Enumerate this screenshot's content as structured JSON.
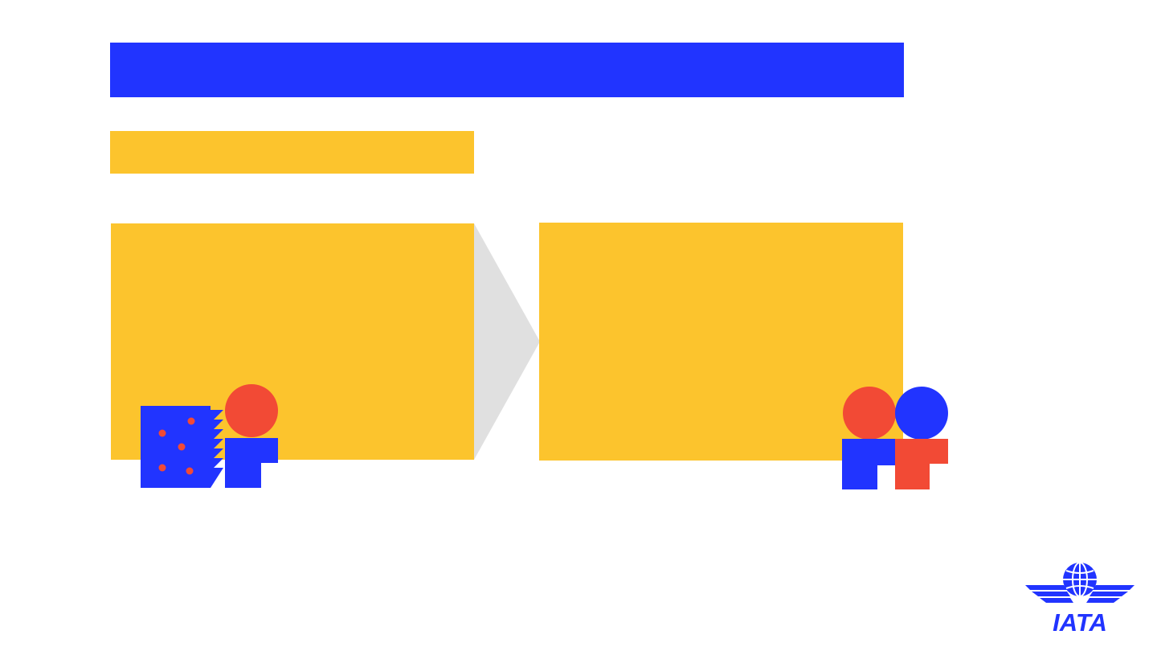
{
  "slide": {
    "title": "",
    "subtitle": "",
    "left_panel_text": "",
    "right_panel_text": ""
  },
  "colors": {
    "primary_blue": "#2134ff",
    "accent_yellow": "#fcc42d",
    "accent_red": "#f24a35",
    "chevron_gray": "#e0e0e0",
    "background": "#ffffff"
  },
  "illustrations": {
    "left": "person-with-document-icon",
    "right": "two-people-icon"
  },
  "logo": {
    "text": "IATA",
    "icon": "iata-globe-wings-logo"
  }
}
